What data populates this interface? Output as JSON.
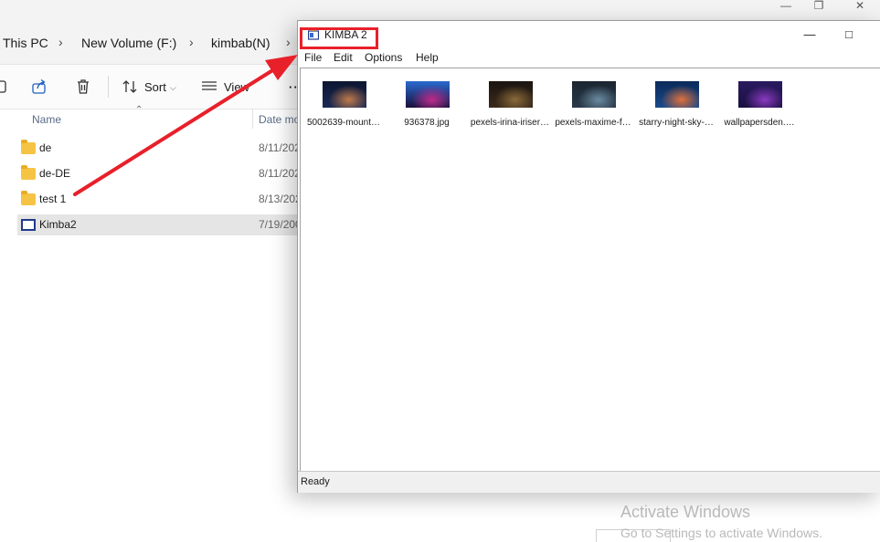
{
  "explorer": {
    "breadcrumb": [
      "This PC",
      "New Volume (F:)",
      "kimbab(N)"
    ],
    "toolbar": {
      "sort_label": "Sort",
      "view_label": "View"
    },
    "columns": {
      "name": "Name",
      "date": "Date mo"
    },
    "files": [
      {
        "name": "de",
        "date": "8/11/202",
        "type": "folder"
      },
      {
        "name": "de-DE",
        "date": "8/11/202",
        "type": "folder"
      },
      {
        "name": "test 1",
        "date": "8/13/202",
        "type": "folder"
      },
      {
        "name": "Kimba2",
        "date": "7/19/200",
        "type": "application",
        "selected": true
      }
    ]
  },
  "kimba": {
    "title": "KIMBA 2",
    "menu": [
      "File",
      "Edit",
      "Options",
      "Help"
    ],
    "thumbnails": [
      {
        "caption": "5002639-mount…",
        "colors": [
          "#1a2a55",
          "#c07a4a",
          "#0d1530"
        ]
      },
      {
        "caption": "936378.jpg",
        "colors": [
          "#1a0f3a",
          "#c02a8a",
          "#2a6ad0"
        ]
      },
      {
        "caption": "pexels-irina-iriser…",
        "colors": [
          "#3a2a1a",
          "#8a6a3a",
          "#1a1410"
        ]
      },
      {
        "caption": "pexels-maxime-f…",
        "colors": [
          "#2a3a4a",
          "#6a8aa0",
          "#1a2530"
        ]
      },
      {
        "caption": "starry-night-sky-…",
        "colors": [
          "#1a4a8a",
          "#e0703a",
          "#0a2a5a"
        ]
      },
      {
        "caption": "wallpapersden.…",
        "colors": [
          "#1a1040",
          "#8a3ac0",
          "#2a1a60"
        ]
      }
    ],
    "status": "Ready"
  },
  "annotation": {
    "color": "#e8202a"
  },
  "watermark": {
    "title": "Activate Windows",
    "subtitle": "Go to Settings to activate Windows."
  }
}
